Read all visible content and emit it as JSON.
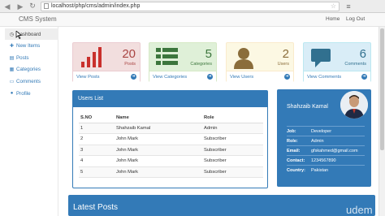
{
  "browser": {
    "url": "localhost/php/cms/admin/index.php"
  },
  "navbar": {
    "brand": "CMS System",
    "home": "Home",
    "logout": "Log Out"
  },
  "sidebar": {
    "items": [
      {
        "label": "Dashboard",
        "icon": "clock-icon"
      },
      {
        "label": "New Items",
        "icon": "plus-icon"
      },
      {
        "label": "Posts",
        "icon": "list-icon"
      },
      {
        "label": "Categories",
        "icon": "folder-icon"
      },
      {
        "label": "Comments",
        "icon": "comment-icon"
      },
      {
        "label": "Profile",
        "icon": "user-icon"
      }
    ]
  },
  "cards": {
    "posts": {
      "count": "20",
      "label": "Posts",
      "link": "View Posts"
    },
    "categories": {
      "count": "5",
      "label": "Categories",
      "link": "View Categories"
    },
    "users": {
      "count": "2",
      "label": "Users",
      "link": "View Users"
    },
    "comments": {
      "count": "6",
      "label": "Comments",
      "link": "View Comments"
    }
  },
  "users_list": {
    "title": "Users List",
    "headers": [
      "S.NO",
      "Name",
      "Role"
    ],
    "rows": [
      [
        "1",
        "Shahzaib Kamal",
        "Admin"
      ],
      [
        "2",
        "John Mark",
        "Subscriber"
      ],
      [
        "3",
        "John Mark",
        "Subscriber"
      ],
      [
        "4",
        "John Mark",
        "Subscriber"
      ],
      [
        "5",
        "John Mark",
        "Subscriber"
      ]
    ]
  },
  "profile": {
    "name": "Shahzaib Kamal",
    "fields": [
      {
        "key": "Job:",
        "value": "Developer"
      },
      {
        "key": "Role:",
        "value": "Admin"
      },
      {
        "key": "Email:",
        "value": "gfskahmed@gmail.com"
      },
      {
        "key": "Contact:",
        "value": "1234567890"
      },
      {
        "key": "Country:",
        "value": "Pakistan"
      }
    ]
  },
  "latest": {
    "title": "Latest Posts"
  },
  "watermark": "udem",
  "colors": {
    "primary": "#337ab7",
    "posts": "#a94442",
    "categories": "#3c763d",
    "users": "#8a6d3b",
    "comments": "#31708f"
  }
}
